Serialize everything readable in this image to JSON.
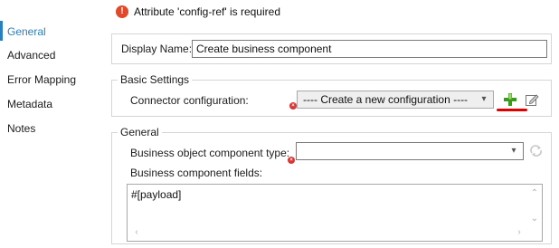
{
  "nav": {
    "items": [
      {
        "label": "General",
        "active": true
      },
      {
        "label": "Advanced",
        "active": false
      },
      {
        "label": "Error Mapping",
        "active": false
      },
      {
        "label": "Metadata",
        "active": false
      },
      {
        "label": "Notes",
        "active": false
      }
    ]
  },
  "error": {
    "icon": "error-icon",
    "message": "Attribute 'config-ref' is required"
  },
  "display_name": {
    "label": "Display Name:",
    "value": "Create business component"
  },
  "basic_settings": {
    "title": "Basic Settings",
    "connector_label": "Connector configuration:",
    "connector_selected": "---- Create a new configuration ----"
  },
  "general": {
    "title": "General",
    "bo_type_label": "Business object component type:",
    "bo_type_value": "",
    "fields_label": "Business component fields:",
    "fields_value": "#[payload]"
  },
  "colors": {
    "accent": "#2a7fc1",
    "error": "#e1492b",
    "add": "#3a9a1c",
    "highlight": "#e00000"
  }
}
